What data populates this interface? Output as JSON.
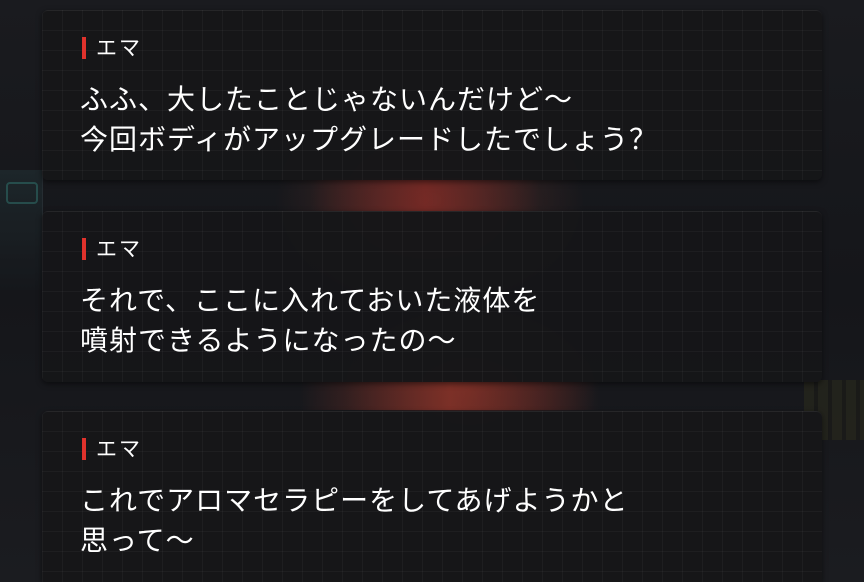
{
  "dialogue_log": [
    {
      "speaker": "エマ",
      "lines": [
        "ふふ、大したことじゃないんだけど～",
        "今回ボディがアップグレードしたでしょう？"
      ]
    },
    {
      "speaker": "エマ",
      "lines": [
        "それで、ここに入れておいた液体を",
        "噴射できるようになったの～"
      ]
    },
    {
      "speaker": "エマ",
      "lines": [
        "これでアロマセラピーをしてあげようかと",
        "思って～"
      ]
    }
  ],
  "colors": {
    "speaker_marker": "#e0322c",
    "text": "#ffffff",
    "panel_background": "#161618"
  }
}
